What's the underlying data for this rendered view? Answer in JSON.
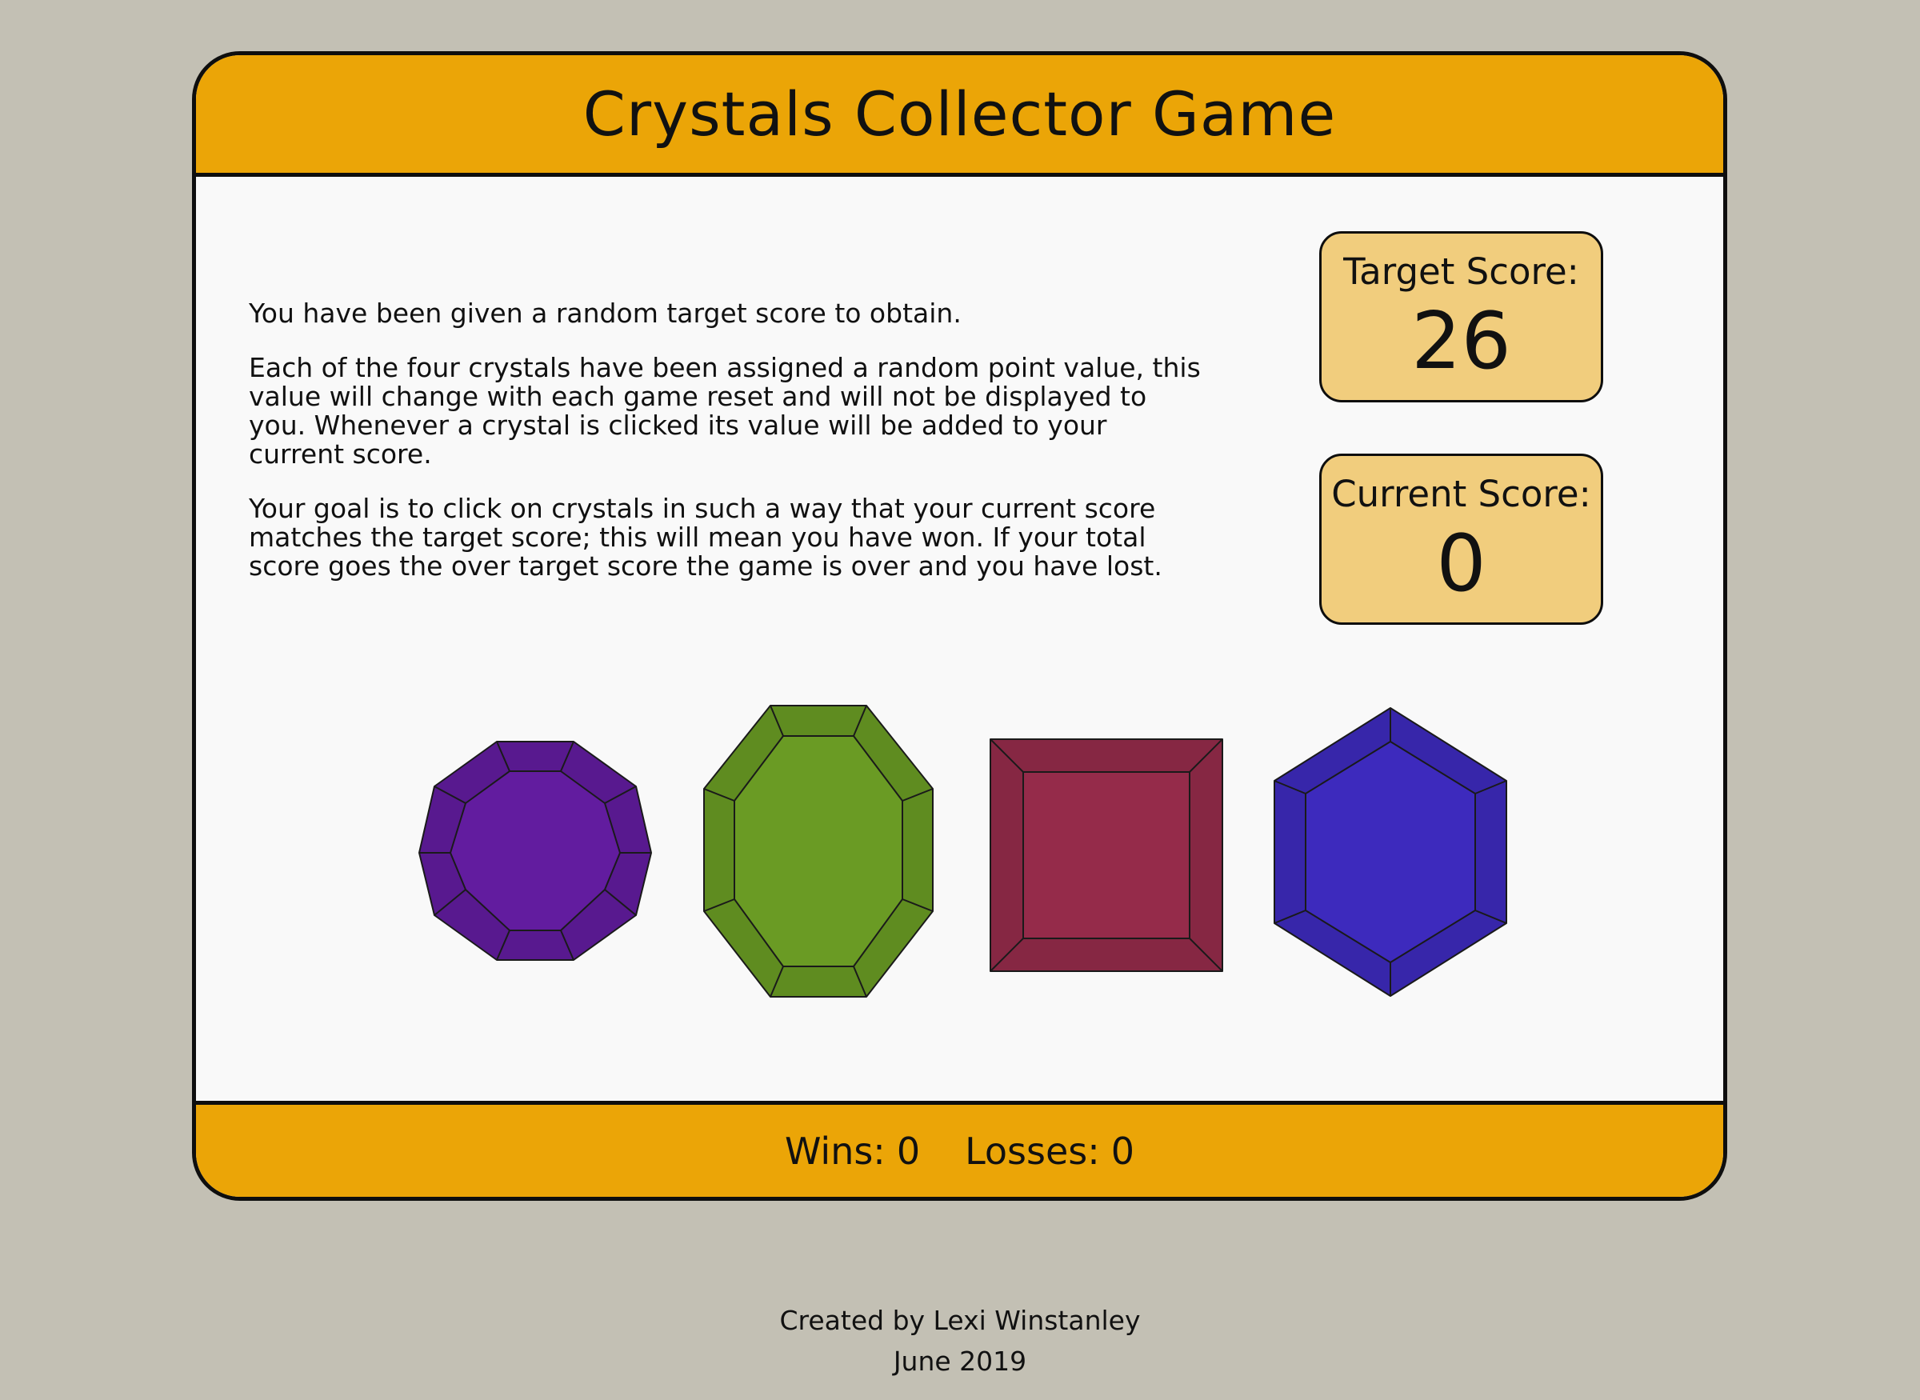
{
  "header": {
    "title": "Crystals Collector Game"
  },
  "instructions": [
    "You have been given a random target score to obtain.",
    "Each of the four crystals have been assigned a random point value, this value will change with each game reset and will not be displayed to you. Whenever a crystal is clicked its value will be added to your current score.",
    "Your goal is to click on crystals in such a way that your current score matches the target score; this will mean you have won. If your total score goes the over target score the game is over and you have lost."
  ],
  "scores": {
    "target_label": "Target Score:",
    "target_value": "26",
    "current_label": "Current Score:",
    "current_value": "0"
  },
  "crystals": [
    {
      "name": "purple-crystal",
      "color": "#621c9f"
    },
    {
      "name": "green-crystal",
      "color": "#6a9b24"
    },
    {
      "name": "red-crystal",
      "color": "#952b4a"
    },
    {
      "name": "blue-crystal",
      "color": "#3d2abd"
    }
  ],
  "footer": {
    "wins_label": "Wins:",
    "wins_value": "0",
    "losses_label": "Losses:",
    "losses_value": "0"
  },
  "credits": {
    "author": "Created by Lexi Winstanley",
    "date": "June 2019"
  }
}
